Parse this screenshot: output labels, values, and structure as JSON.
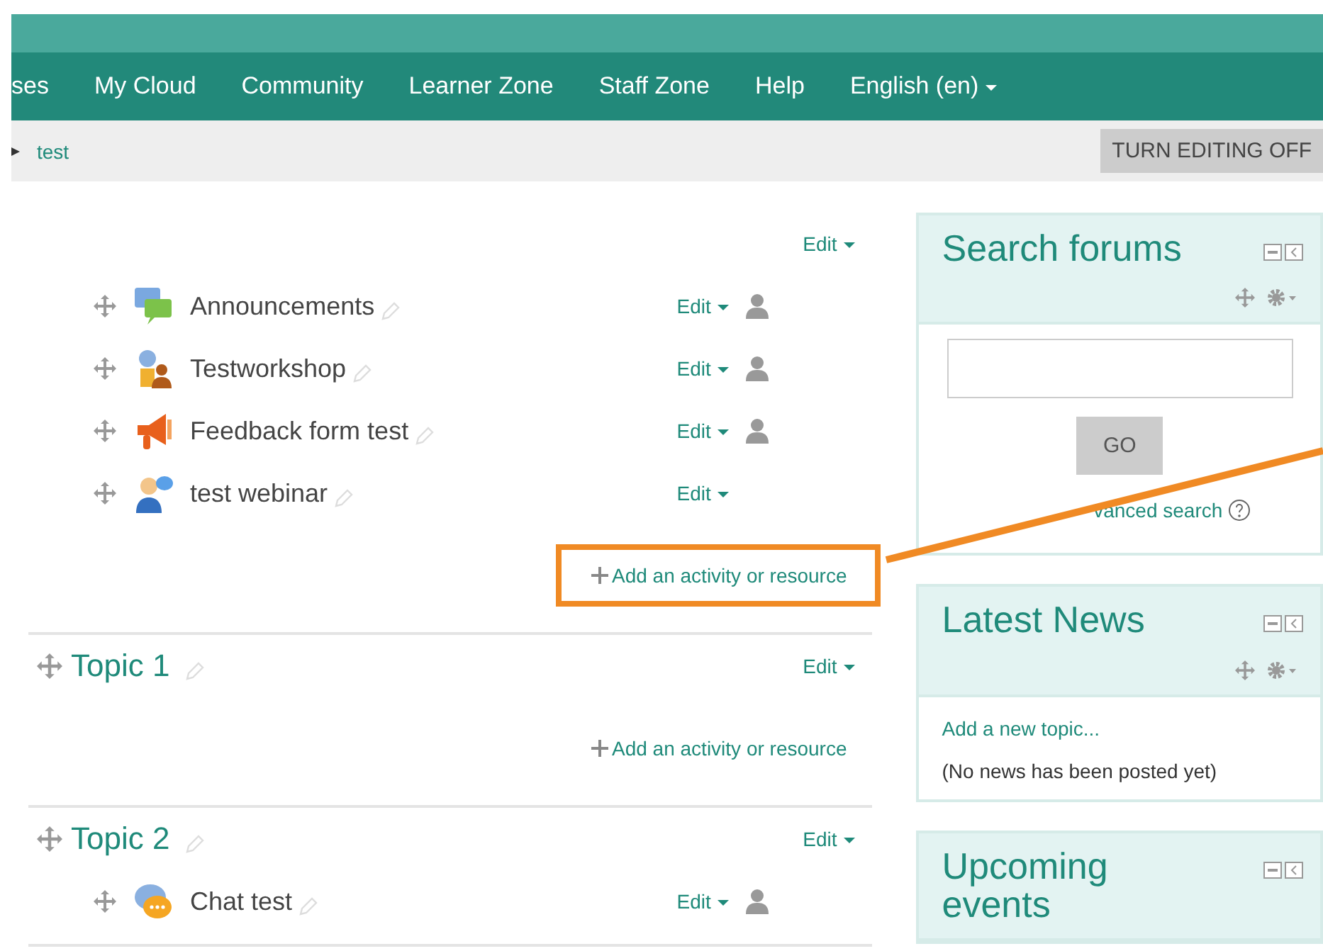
{
  "nav": {
    "items": [
      "ses",
      "My Cloud",
      "Community",
      "Learner Zone",
      "Staff Zone",
      "Help"
    ],
    "language": "English (en)"
  },
  "breadcrumb": {
    "current": "test"
  },
  "editing_button": "TURN EDITING OFF",
  "sections": [
    {
      "edit": "Edit",
      "add_link": "Add an activity or resource",
      "callout": true,
      "activities": [
        {
          "name": "Announcements",
          "kind": "forum",
          "edit": "Edit",
          "restricted": true
        },
        {
          "name": "Testworkshop",
          "kind": "workshop",
          "edit": "Edit",
          "restricted": true
        },
        {
          "name": "Feedback form test",
          "kind": "feedback",
          "edit": "Edit",
          "restricted": true
        },
        {
          "name": "test webinar",
          "kind": "webinar",
          "edit": "Edit",
          "restricted": false
        }
      ]
    },
    {
      "title": "Topic 1",
      "edit": "Edit",
      "add_link": "Add an activity or resource",
      "callout": false
    },
    {
      "title": "Topic 2",
      "edit": "Edit",
      "activities": [
        {
          "name": "Chat test",
          "kind": "chat",
          "edit": "Edit",
          "restricted": true
        }
      ]
    }
  ],
  "blocks": [
    {
      "kind": "search",
      "title": "Search forums",
      "button": "GO",
      "link": "vanced search"
    },
    {
      "kind": "news",
      "title": "Latest News",
      "link": "Add a new topic...",
      "note": "(No news has been posted yet)"
    },
    {
      "kind": "events",
      "title": "Upcoming events"
    }
  ]
}
